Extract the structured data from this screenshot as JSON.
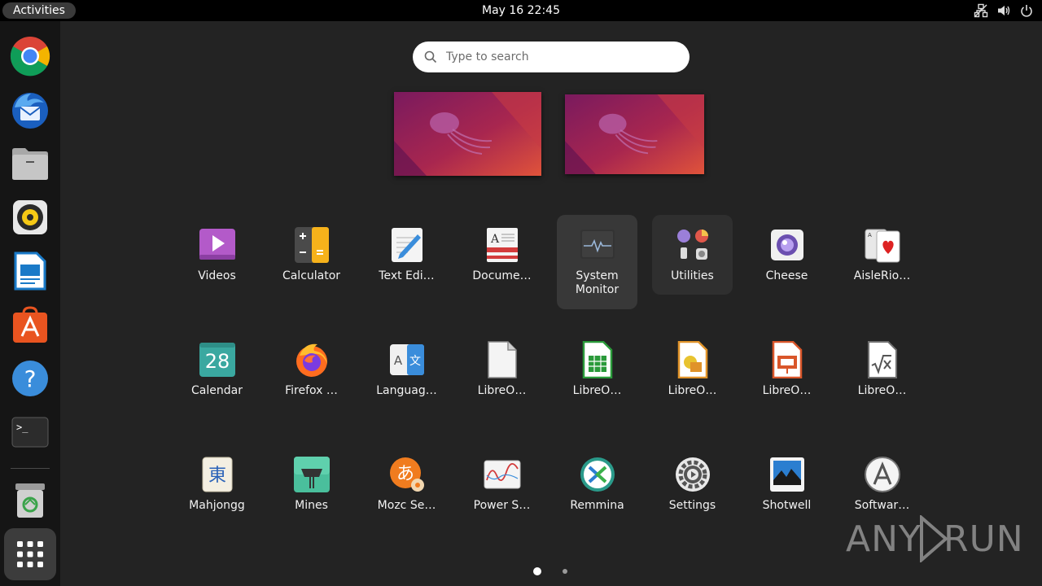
{
  "topbar": {
    "activities_label": "Activities",
    "clock": "May 16  22:45",
    "tray_icons": [
      "network-icon",
      "volume-icon",
      "power-icon"
    ]
  },
  "dock": {
    "items": [
      {
        "name": "Google Chrome",
        "icon": "chrome-icon",
        "running": false
      },
      {
        "name": "Thunderbird",
        "icon": "thunderbird-icon",
        "running": false
      },
      {
        "name": "Files",
        "icon": "files-icon",
        "running": false
      },
      {
        "name": "Rhythmbox",
        "icon": "rhythmbox-icon",
        "running": false
      },
      {
        "name": "LibreOffice Writer",
        "icon": "writer-icon",
        "running": false
      },
      {
        "name": "Ubuntu Software",
        "icon": "software-icon",
        "running": false
      },
      {
        "name": "Help",
        "icon": "help-icon",
        "running": false
      },
      {
        "name": "Terminal",
        "icon": "terminal-icon",
        "running": false
      },
      {
        "name": "Trash",
        "icon": "trash-icon",
        "running": false
      }
    ],
    "show_apps": "show-apps-icon"
  },
  "search": {
    "placeholder": "Type to search"
  },
  "workspaces": [
    "workspace-1",
    "workspace-2"
  ],
  "apps": {
    "row1": [
      {
        "label": "Videos",
        "icon": "videos-icon"
      },
      {
        "label": "Calculator",
        "icon": "calculator-icon"
      },
      {
        "label": "Text Edi…",
        "icon": "text-editor-icon"
      },
      {
        "label": "Docume…",
        "icon": "document-viewer-icon"
      },
      {
        "label": "System Monitor",
        "icon": "system-monitor-icon",
        "selected": true
      },
      {
        "label": "Utilities",
        "icon": "utilities-folder-icon",
        "folder": true
      },
      {
        "label": "Cheese",
        "icon": "cheese-icon"
      },
      {
        "label": "AisleRio…",
        "icon": "aisleriot-icon"
      }
    ],
    "row2": [
      {
        "label": "Calendar",
        "icon": "calendar-icon",
        "day": "28"
      },
      {
        "label": "Firefox …",
        "icon": "firefox-icon"
      },
      {
        "label": "Languag…",
        "icon": "language-icon"
      },
      {
        "label": "LibreO…",
        "icon": "libreoffice-icon"
      },
      {
        "label": "LibreO…",
        "icon": "libreoffice-calc-icon"
      },
      {
        "label": "LibreO…",
        "icon": "libreoffice-draw-icon"
      },
      {
        "label": "LibreO…",
        "icon": "libreoffice-impress-icon"
      },
      {
        "label": "LibreO…",
        "icon": "libreoffice-math-icon"
      }
    ],
    "row3": [
      {
        "label": "Mahjongg",
        "icon": "mahjongg-icon",
        "glyph": "東"
      },
      {
        "label": "Mines",
        "icon": "mines-icon"
      },
      {
        "label": "Mozc Se…",
        "icon": "mozc-icon",
        "glyph": "あ"
      },
      {
        "label": "Power S…",
        "icon": "power-statistics-icon"
      },
      {
        "label": "Remmina",
        "icon": "remmina-icon"
      },
      {
        "label": "Settings",
        "icon": "settings-icon"
      },
      {
        "label": "Shotwell",
        "icon": "shotwell-icon"
      },
      {
        "label": "Softwar…",
        "icon": "software-updater-icon"
      }
    ]
  },
  "pager": {
    "pages": 2,
    "current": 1
  },
  "watermark": {
    "left": "ANY",
    "right": "RUN"
  }
}
